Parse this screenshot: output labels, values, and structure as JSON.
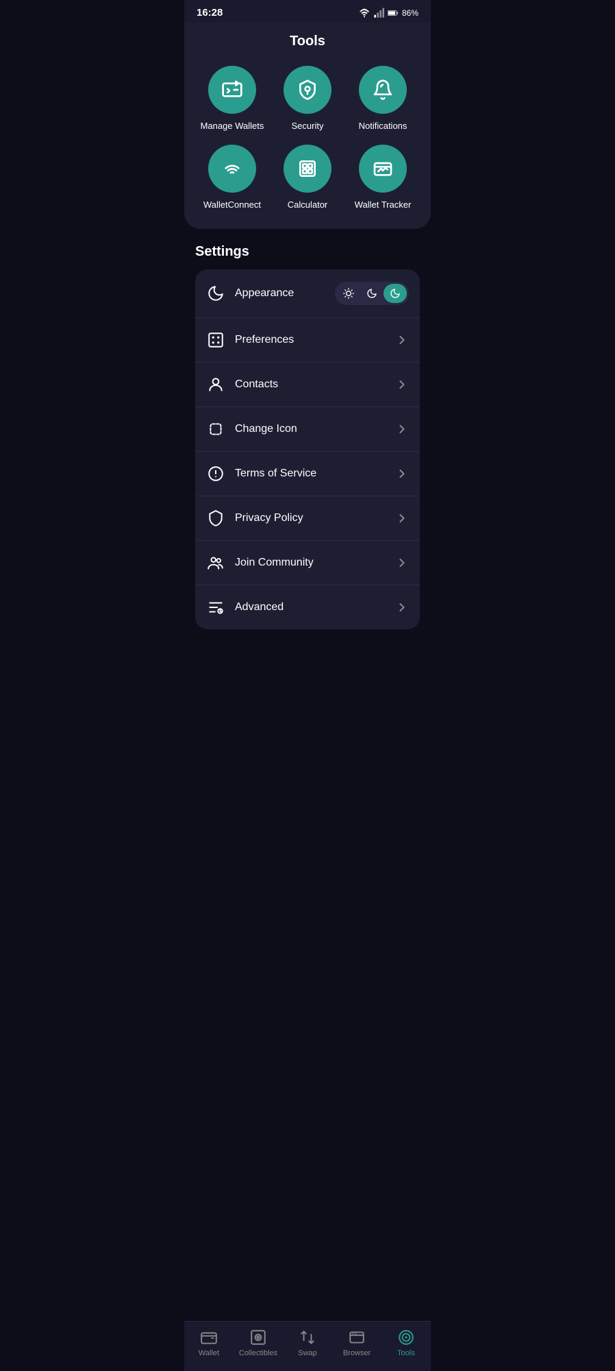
{
  "statusBar": {
    "time": "16:28",
    "battery": "86%"
  },
  "tools": {
    "title": "Tools",
    "items": [
      {
        "id": "manage-wallets",
        "label": "Manage Wallets"
      },
      {
        "id": "security",
        "label": "Security"
      },
      {
        "id": "notifications",
        "label": "Notifications"
      },
      {
        "id": "walletconnect",
        "label": "WalletConnect"
      },
      {
        "id": "calculator",
        "label": "Calculator"
      },
      {
        "id": "wallet-tracker",
        "label": "Wallet Tracker"
      }
    ]
  },
  "settings": {
    "title": "Settings",
    "rows": [
      {
        "id": "appearance",
        "label": "Appearance",
        "hasToggle": true
      },
      {
        "id": "preferences",
        "label": "Preferences",
        "hasArrow": true
      },
      {
        "id": "contacts",
        "label": "Contacts",
        "hasArrow": true
      },
      {
        "id": "change-icon",
        "label": "Change Icon",
        "hasArrow": true
      },
      {
        "id": "terms",
        "label": "Terms of Service",
        "hasArrow": true
      },
      {
        "id": "privacy",
        "label": "Privacy Policy",
        "hasArrow": true
      },
      {
        "id": "community",
        "label": "Join Community",
        "hasArrow": true
      },
      {
        "id": "advanced",
        "label": "Advanced",
        "hasArrow": true
      }
    ]
  },
  "bottomNav": {
    "items": [
      {
        "id": "wallet",
        "label": "Wallet",
        "active": false
      },
      {
        "id": "collectibles",
        "label": "Collectibles",
        "active": false
      },
      {
        "id": "swap",
        "label": "Swap",
        "active": false
      },
      {
        "id": "browser",
        "label": "Browser",
        "active": false
      },
      {
        "id": "tools",
        "label": "Tools",
        "active": true
      }
    ]
  }
}
